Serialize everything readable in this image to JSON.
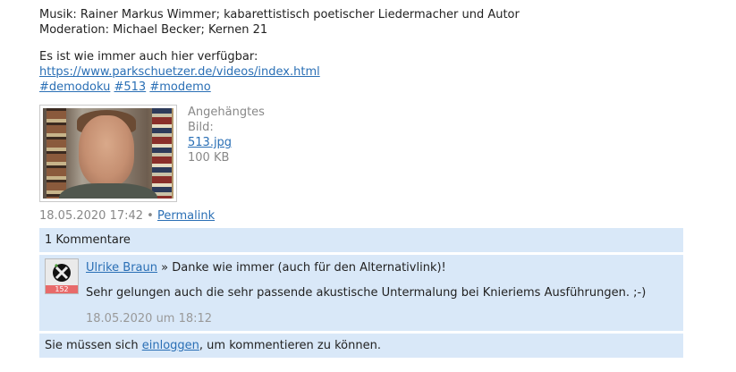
{
  "post": {
    "music_line": "Musik: Rainer Markus Wimmer; kabarettistisch poetischer Liedermacher und Autor",
    "moderation_line": "Moderation: Michael Becker; Kernen 21",
    "available_line": "Es ist wie immer auch hier verfügbar:",
    "link": "https://www.parkschuetzer.de/videos/index.html",
    "tags": [
      "#demodoku",
      "#513",
      "#modemo"
    ],
    "attachment": {
      "label": "Angehängtes Bild:",
      "filename": "513.jpg",
      "size": "100 KB"
    },
    "date": "18.05.2020 17:42",
    "separator": "•",
    "permalink": "Permalink"
  },
  "comments": {
    "count_label": "1 Kommentare",
    "items": [
      {
        "author": "Ulrike Braun",
        "arrow": "»",
        "title": "Danke wie immer (auch für den Alternativlink)!",
        "body": "Sehr gelungen auch die sehr passende akustische Untermalung bei Knieriems Ausführungen. ;-)",
        "date": "18.05.2020 um 18:12",
        "avatar_badge": "152"
      }
    ],
    "login_prefix": "Sie müssen sich",
    "login_link": "einloggen",
    "login_suffix": ", um kommentieren zu können."
  },
  "colors": {
    "link": "#2a6fb5",
    "panel": "#d9e8f8",
    "muted": "#888888"
  }
}
